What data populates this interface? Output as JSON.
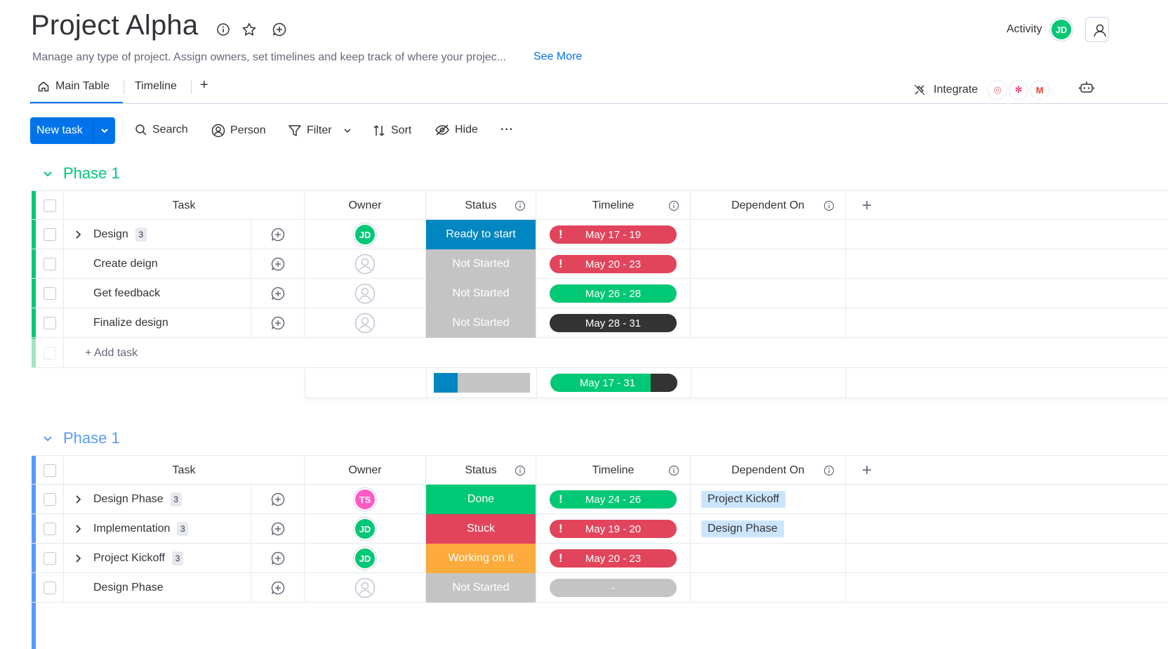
{
  "header": {
    "title": "Project Alpha",
    "description": "Manage any type of project. Assign owners, set timelines and keep track of where your projec...",
    "see_more": "See More",
    "activity": "Activity",
    "user_initials": "JD"
  },
  "tabs": [
    {
      "label": "Main Table",
      "active": true
    },
    {
      "label": "Timeline",
      "active": false
    }
  ],
  "add_tab": "+",
  "integrate": {
    "label": "Integrate",
    "logos": [
      "◎",
      "✻",
      "M"
    ]
  },
  "toolbar": {
    "new_task": "New task",
    "search": "Search",
    "person": "Person",
    "filter": "Filter",
    "sort": "Sort",
    "hide": "Hide",
    "more": "···"
  },
  "columns": {
    "task": "Task",
    "owner": "Owner",
    "status": "Status",
    "timeline": "Timeline",
    "dependent_on": "Dependent On",
    "add": "+"
  },
  "colors": {
    "ready": "#0086c0",
    "not_started": "#c4c4c4",
    "done": "#00c875",
    "stuck": "#e2445c",
    "working": "#fdab3d",
    "tl_red": "#e2445c",
    "tl_green": "#00c875",
    "tl_dark": "#333333",
    "tl_empty": "#c4c4c4"
  },
  "groups": [
    {
      "title": "Phase 1",
      "color": "#00c875",
      "rows": [
        {
          "task": "Design",
          "subitems": "3",
          "owner": "JD",
          "status": "Ready to start",
          "status_color": "ready",
          "timeline": "May 17 - 19",
          "tl_color": "tl_red",
          "alert": true,
          "dep": ""
        },
        {
          "task": "Create deign",
          "subitems": "",
          "owner": "",
          "status": "Not Started",
          "status_color": "not_started",
          "timeline": "May 20 - 23",
          "tl_color": "tl_red",
          "alert": true,
          "dep": ""
        },
        {
          "task": "Get feedback",
          "subitems": "",
          "owner": "",
          "status": "Not Started",
          "status_color": "not_started",
          "timeline": "May 26 - 28",
          "tl_color": "tl_green",
          "alert": false,
          "dep": ""
        },
        {
          "task": "Finalize design",
          "subitems": "",
          "owner": "",
          "status": "Not Started",
          "status_color": "not_started",
          "timeline": "May 28 - 31",
          "tl_color": "tl_dark",
          "alert": false,
          "dep": ""
        }
      ],
      "add_task": "+ Add task",
      "summary_timeline": "May 17 - 31",
      "summary_status_fraction": 0.25
    },
    {
      "title": "Phase 1",
      "color": "#579bfc",
      "rows": [
        {
          "task": "Design Phase",
          "subitems": "3",
          "owner": "TS",
          "owner_color": "pink",
          "status": "Done",
          "status_color": "done",
          "timeline": "May 24 - 26",
          "tl_color": "tl_green",
          "alert": true,
          "dep": "Project Kickoff"
        },
        {
          "task": "Implementation",
          "subitems": "3",
          "owner": "JD",
          "status": "Stuck",
          "status_color": "stuck",
          "timeline": "May 19 - 20",
          "tl_color": "tl_red",
          "alert": true,
          "dep": "Design Phase"
        },
        {
          "task": "Project Kickoff",
          "subitems": "3",
          "owner": "JD",
          "status": "Working on it",
          "status_color": "working",
          "timeline": "May 20 - 23",
          "tl_color": "tl_red",
          "alert": true,
          "dep": ""
        },
        {
          "task": "Design Phase",
          "subitems": "",
          "owner": "",
          "status": "Not Started",
          "status_color": "not_started",
          "timeline": "-",
          "tl_color": "tl_empty",
          "alert": false,
          "dep": ""
        }
      ]
    }
  ]
}
